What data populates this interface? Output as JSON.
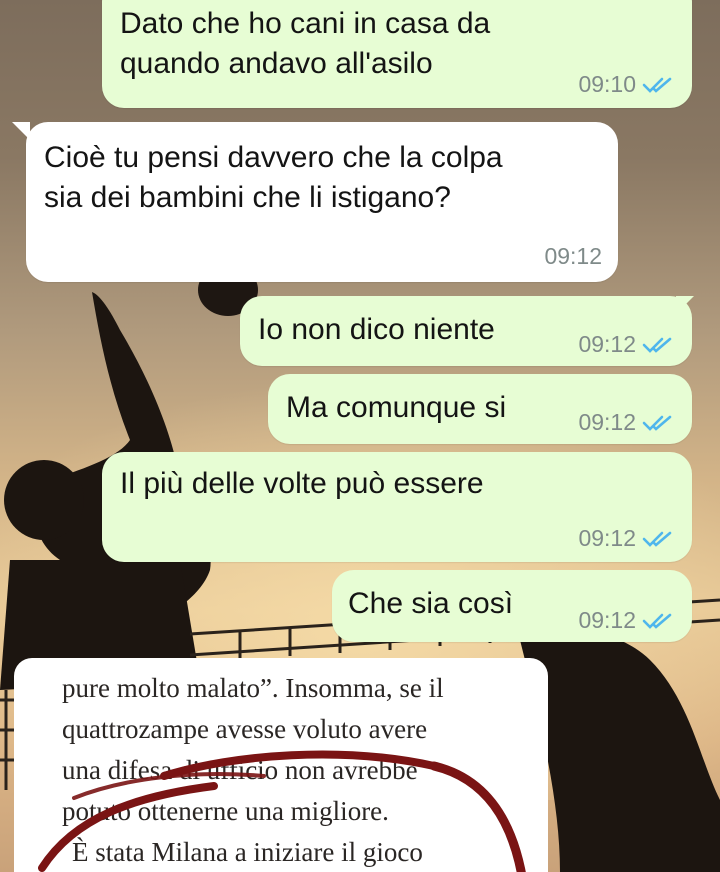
{
  "messages": [
    {
      "direction": "out",
      "text": "Dato che ho cani in casa da\nquando andavo all'asilo",
      "time": "09:10",
      "status": "read"
    },
    {
      "direction": "in",
      "text": "Cioè tu pensi davvero che la colpa\nsia dei bambini che li istigano?",
      "time": "09:12"
    },
    {
      "direction": "out",
      "text": "Io non dico niente",
      "time": "09:12",
      "status": "read"
    },
    {
      "direction": "out",
      "text": "Ma comunque si",
      "time": "09:12",
      "status": "read"
    },
    {
      "direction": "out",
      "text": "Il più delle volte può essere",
      "time": "09:12",
      "status": "read"
    },
    {
      "direction": "out",
      "text": "Che sia così",
      "time": "09:12",
      "status": "read"
    }
  ],
  "image_message": {
    "lines": [
      "pure molto malato”. Insomma, se il",
      "quattrozampe avesse voluto avere",
      "una difesa di ufficio non avrebbe",
      "potuto ottenerne una migliore.",
      "È stata Milana a iniziare il gioco"
    ]
  },
  "colors": {
    "outgoing_bubble": "#e7fdd4",
    "incoming_bubble": "#ffffff",
    "read_ticks": "#4fb6ec",
    "timestamp": "#7f8a89",
    "scribble": "#7a1414"
  },
  "icons": {
    "read_receipt": "double-check-icon"
  }
}
